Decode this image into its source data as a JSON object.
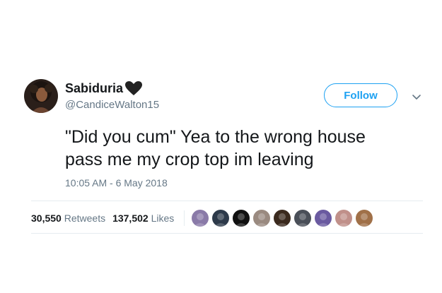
{
  "tweet": {
    "author": {
      "display_name": "Sabiduria",
      "emoji": "black-heart-icon",
      "handle": "@CandiceWalton15"
    },
    "follow_label": "Follow",
    "text_lines": [
      "\"Did you cum\" Yea to the wrong house",
      "pass me my crop top im leaving"
    ],
    "timestamp": "10:05 AM - 6 May 2018",
    "stats": {
      "retweets_count": "30,550",
      "retweets_label": "Retweets",
      "likes_count": "137,502",
      "likes_label": "Likes"
    },
    "likers": [
      {
        "name": "liker-avatar-1",
        "color": "#8a7aa8"
      },
      {
        "name": "liker-avatar-2",
        "color": "#2d3a4a"
      },
      {
        "name": "liker-avatar-3",
        "color": "#111111"
      },
      {
        "name": "liker-avatar-4",
        "color": "#9a8a80"
      },
      {
        "name": "liker-avatar-5",
        "color": "#3b2a1e"
      },
      {
        "name": "liker-avatar-6",
        "color": "#4a4f58"
      },
      {
        "name": "liker-avatar-7",
        "color": "#6a5aa0"
      },
      {
        "name": "liker-avatar-8",
        "color": "#c0908a"
      },
      {
        "name": "liker-avatar-9",
        "color": "#a07048"
      }
    ]
  },
  "colors": {
    "accent": "#1da1f2",
    "text": "#14171a",
    "muted": "#657786",
    "divider": "#e6ecf0"
  }
}
